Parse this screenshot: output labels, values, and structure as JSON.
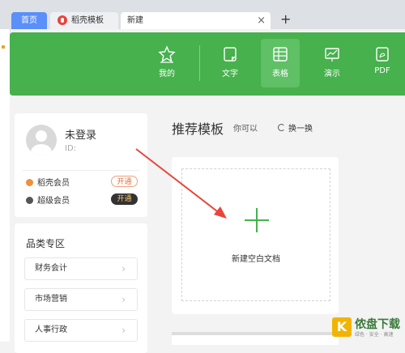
{
  "tabs": {
    "home": "首页",
    "daoke": "稻壳模板",
    "new": "新建",
    "close": "×",
    "add": "+"
  },
  "toolbar": {
    "items": [
      {
        "label": "我的",
        "icon": "star-icon"
      },
      {
        "label": "文字",
        "icon": "document-icon"
      },
      {
        "label": "表格",
        "icon": "table-icon"
      },
      {
        "label": "演示",
        "icon": "presentation-icon"
      },
      {
        "label": "PDF",
        "icon": "pdf-icon"
      }
    ],
    "active": "表格"
  },
  "user": {
    "name": "未登录",
    "id_label": "ID:",
    "members": [
      {
        "label": "稻壳会员",
        "button": "开通"
      },
      {
        "label": "超级会员",
        "button": "开通"
      }
    ]
  },
  "categories": {
    "title": "品类专区",
    "items": [
      "财务会计",
      "市场营销",
      "人事行政"
    ]
  },
  "recommend": {
    "title": "推荐模板",
    "hint": "你可以",
    "refresh": "换一换",
    "new_blank": "新建空白文档"
  },
  "watermark": {
    "logo": "K",
    "name": "侬盘下载",
    "sub": "绿色 · 安全 · 高速"
  },
  "colors": {
    "toolbar_green": "#46b14d",
    "home_tab_blue": "#5b8ff9",
    "arrow_red": "#e8453c"
  }
}
